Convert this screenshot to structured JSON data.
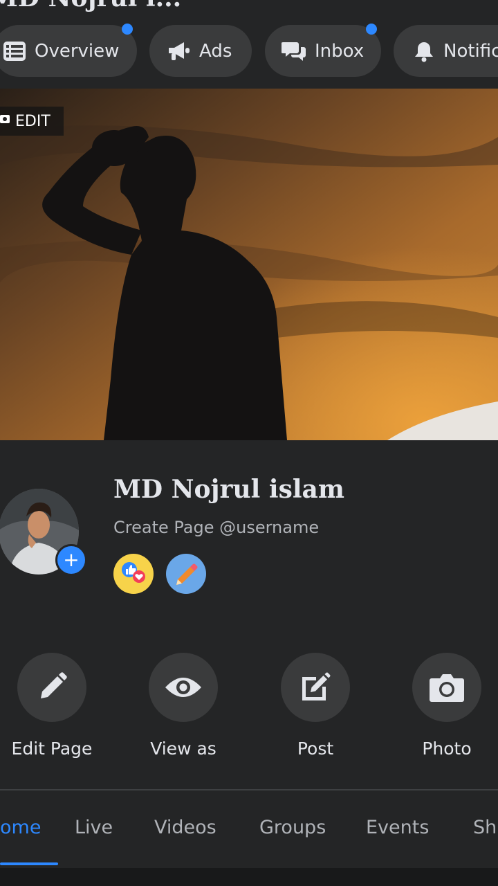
{
  "header": {
    "title": "MD Nojrul i...",
    "nav": [
      {
        "label": "Overview",
        "icon": "list-icon",
        "has_dot": true
      },
      {
        "label": "Ads",
        "icon": "megaphone-icon",
        "has_dot": false
      },
      {
        "label": "Inbox",
        "icon": "chat-icon",
        "has_dot": true
      },
      {
        "label": "Notific",
        "icon": "bell-icon",
        "has_dot": false
      }
    ]
  },
  "cover": {
    "edit_label": "EDIT"
  },
  "profile": {
    "name": "MD Nojrul islam",
    "subtitle": "Create Page @username"
  },
  "actions": [
    {
      "label": "Edit Page",
      "icon": "pencil-icon"
    },
    {
      "label": "View as",
      "icon": "eye-icon"
    },
    {
      "label": "Post",
      "icon": "compose-icon"
    },
    {
      "label": "Photo",
      "icon": "camera-icon"
    }
  ],
  "tabs": [
    {
      "label": "ome",
      "active": true
    },
    {
      "label": "Live",
      "active": false
    },
    {
      "label": "Videos",
      "active": false
    },
    {
      "label": "Groups",
      "active": false
    },
    {
      "label": "Events",
      "active": false
    },
    {
      "label": "Sh",
      "active": false
    }
  ],
  "colors": {
    "accent": "#2d88ff",
    "background": "#242526",
    "pill": "#3a3b3c"
  }
}
